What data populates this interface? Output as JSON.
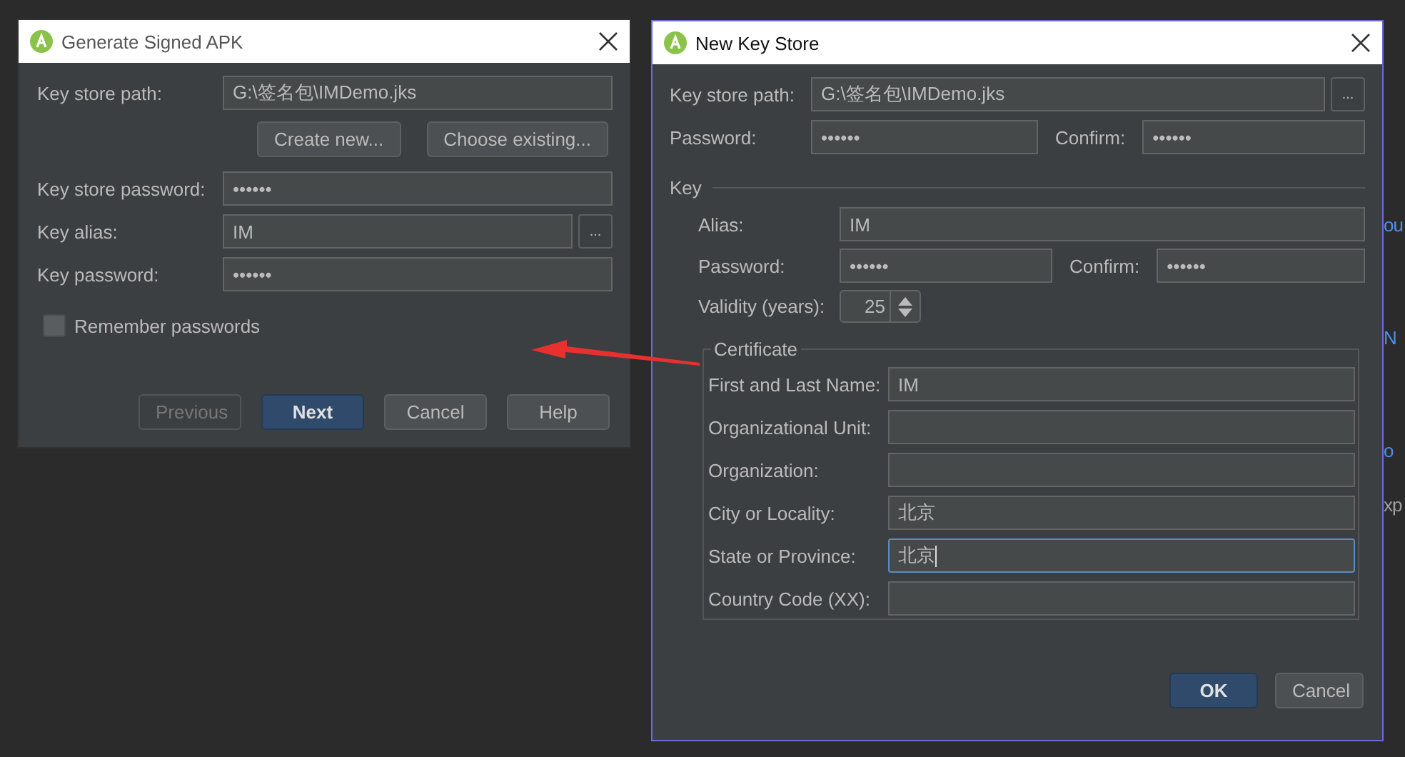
{
  "background_fragments": [
    {
      "text": "ou",
      "kind": "link"
    },
    {
      "text": "N",
      "kind": "link"
    },
    {
      "text": "o",
      "kind": "link"
    },
    {
      "text": "xp",
      "kind": "text"
    }
  ],
  "generate_dialog": {
    "title": "Generate Signed APK",
    "key_store_path": {
      "label": "Key store path:",
      "value": "G:\\签名包\\IMDemo.jks"
    },
    "path_buttons": [
      "Create new...",
      "Choose existing..."
    ],
    "fields": [
      {
        "label": "Key store password:",
        "value": "••••••",
        "kind": "plain"
      },
      {
        "label": "Key alias:",
        "value": "IM",
        "kind": "browse",
        "browse": "..."
      },
      {
        "label": "Key password:",
        "value": "••••••",
        "kind": "plain"
      }
    ],
    "remember": {
      "label": "Remember passwords",
      "checked": false
    },
    "buttons": [
      {
        "label": "Previous",
        "disabled": true,
        "default": false
      },
      {
        "label": "Next",
        "disabled": false,
        "default": true
      },
      {
        "label": "Cancel",
        "disabled": false,
        "default": false
      },
      {
        "label": "Help",
        "disabled": false,
        "default": false
      }
    ]
  },
  "new_key_store": {
    "title": "New Key Store",
    "key_store_path": {
      "label": "Key store path:",
      "value": "G:\\签名包\\IMDemo.jks",
      "browse": "..."
    },
    "password": {
      "label": "Password:",
      "value": "••••••",
      "confirm_label": "Confirm:",
      "confirm_value": "••••••"
    },
    "key_section": "Key",
    "alias": {
      "label": "Alias:",
      "value": "IM"
    },
    "key_password": {
      "label": "Password:",
      "value": "••••••",
      "confirm_label": "Confirm:",
      "confirm_value": "••••••"
    },
    "validity": {
      "label": "Validity (years):",
      "value": "25"
    },
    "certificate": {
      "title": "Certificate",
      "fields": [
        {
          "label": "First and Last Name:",
          "value": "IM",
          "focused": false
        },
        {
          "label": "Organizational Unit:",
          "focused": false
        },
        {
          "label": "Organization:",
          "focused": false
        },
        {
          "label": "City or Locality:",
          "value": "北京",
          "focused": false
        },
        {
          "label": "State or Province:",
          "value": "北京",
          "focused": true
        },
        {
          "label": "Country Code (XX):",
          "focused": false
        }
      ]
    },
    "buttons": [
      {
        "label": "OK",
        "default": true
      },
      {
        "label": "Cancel",
        "default": false
      }
    ]
  }
}
